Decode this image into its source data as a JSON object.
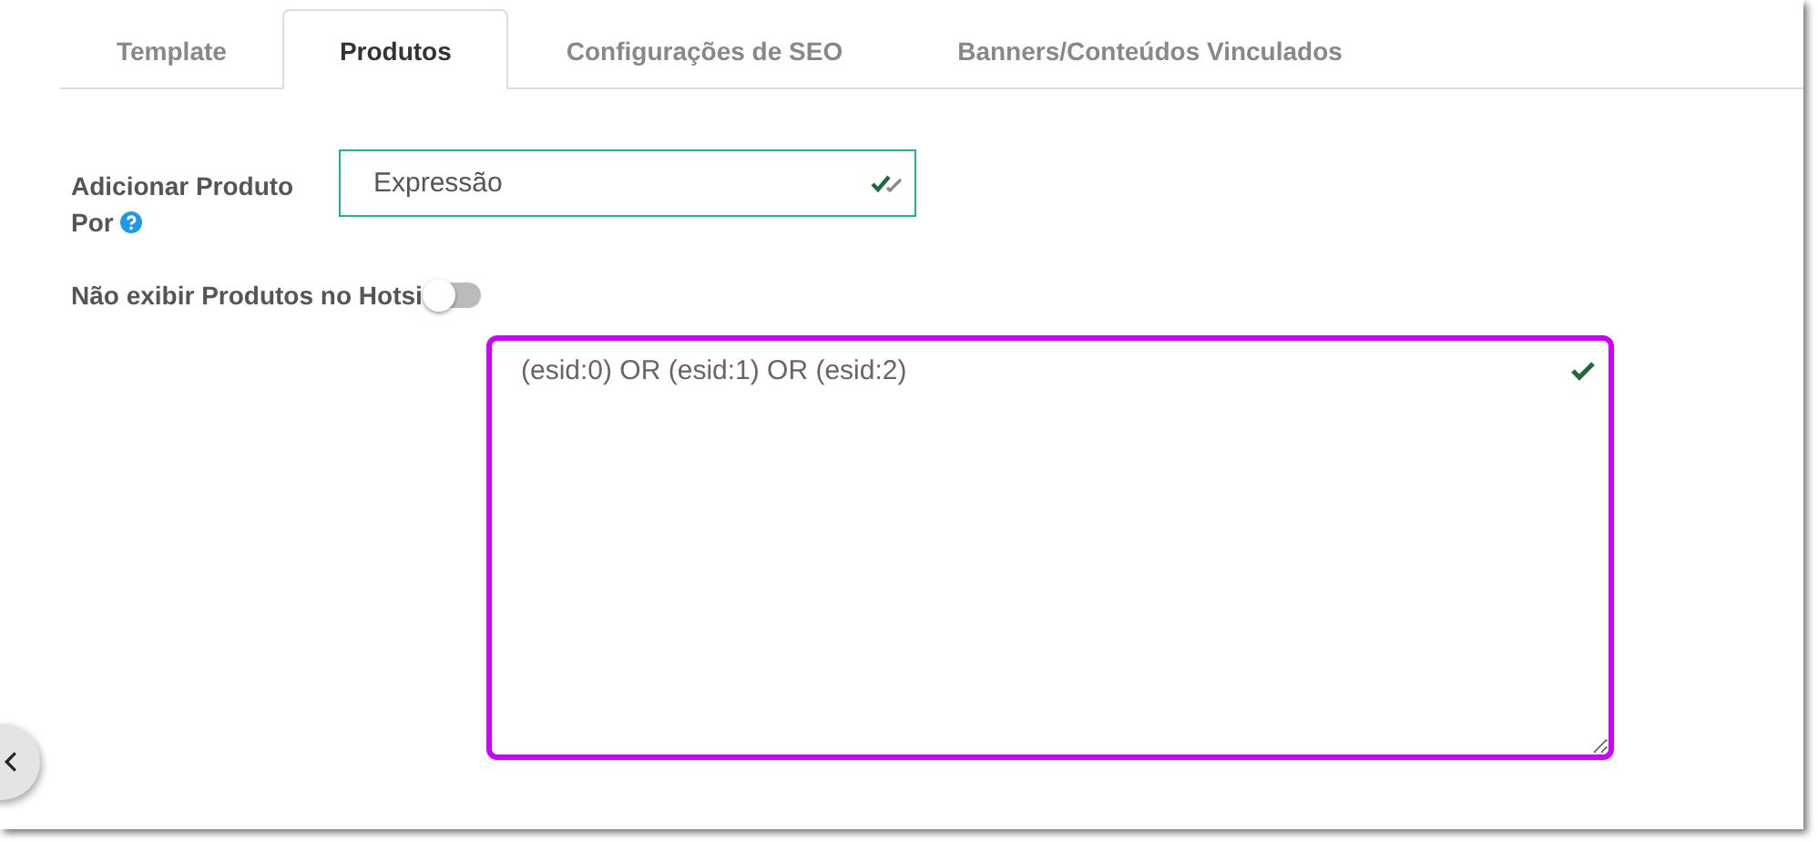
{
  "tabs": [
    {
      "label": "Template",
      "selected": false
    },
    {
      "label": "Produtos",
      "selected": true
    },
    {
      "label": "Configurações de SEO",
      "selected": false
    },
    {
      "label": "Banners/Conteúdos Vinculados",
      "selected": false
    }
  ],
  "add_product_by": {
    "label_lines": [
      "Adicionar Produto",
      "Por"
    ],
    "value": "Expressão",
    "valid": true
  },
  "hide_products": {
    "label": "Não exibir Produtos no Hotsi",
    "on": false
  },
  "expression": {
    "value": "(esid:0) OR (esid:1) OR (esid:2)",
    "valid": true,
    "highlighted": true
  }
}
